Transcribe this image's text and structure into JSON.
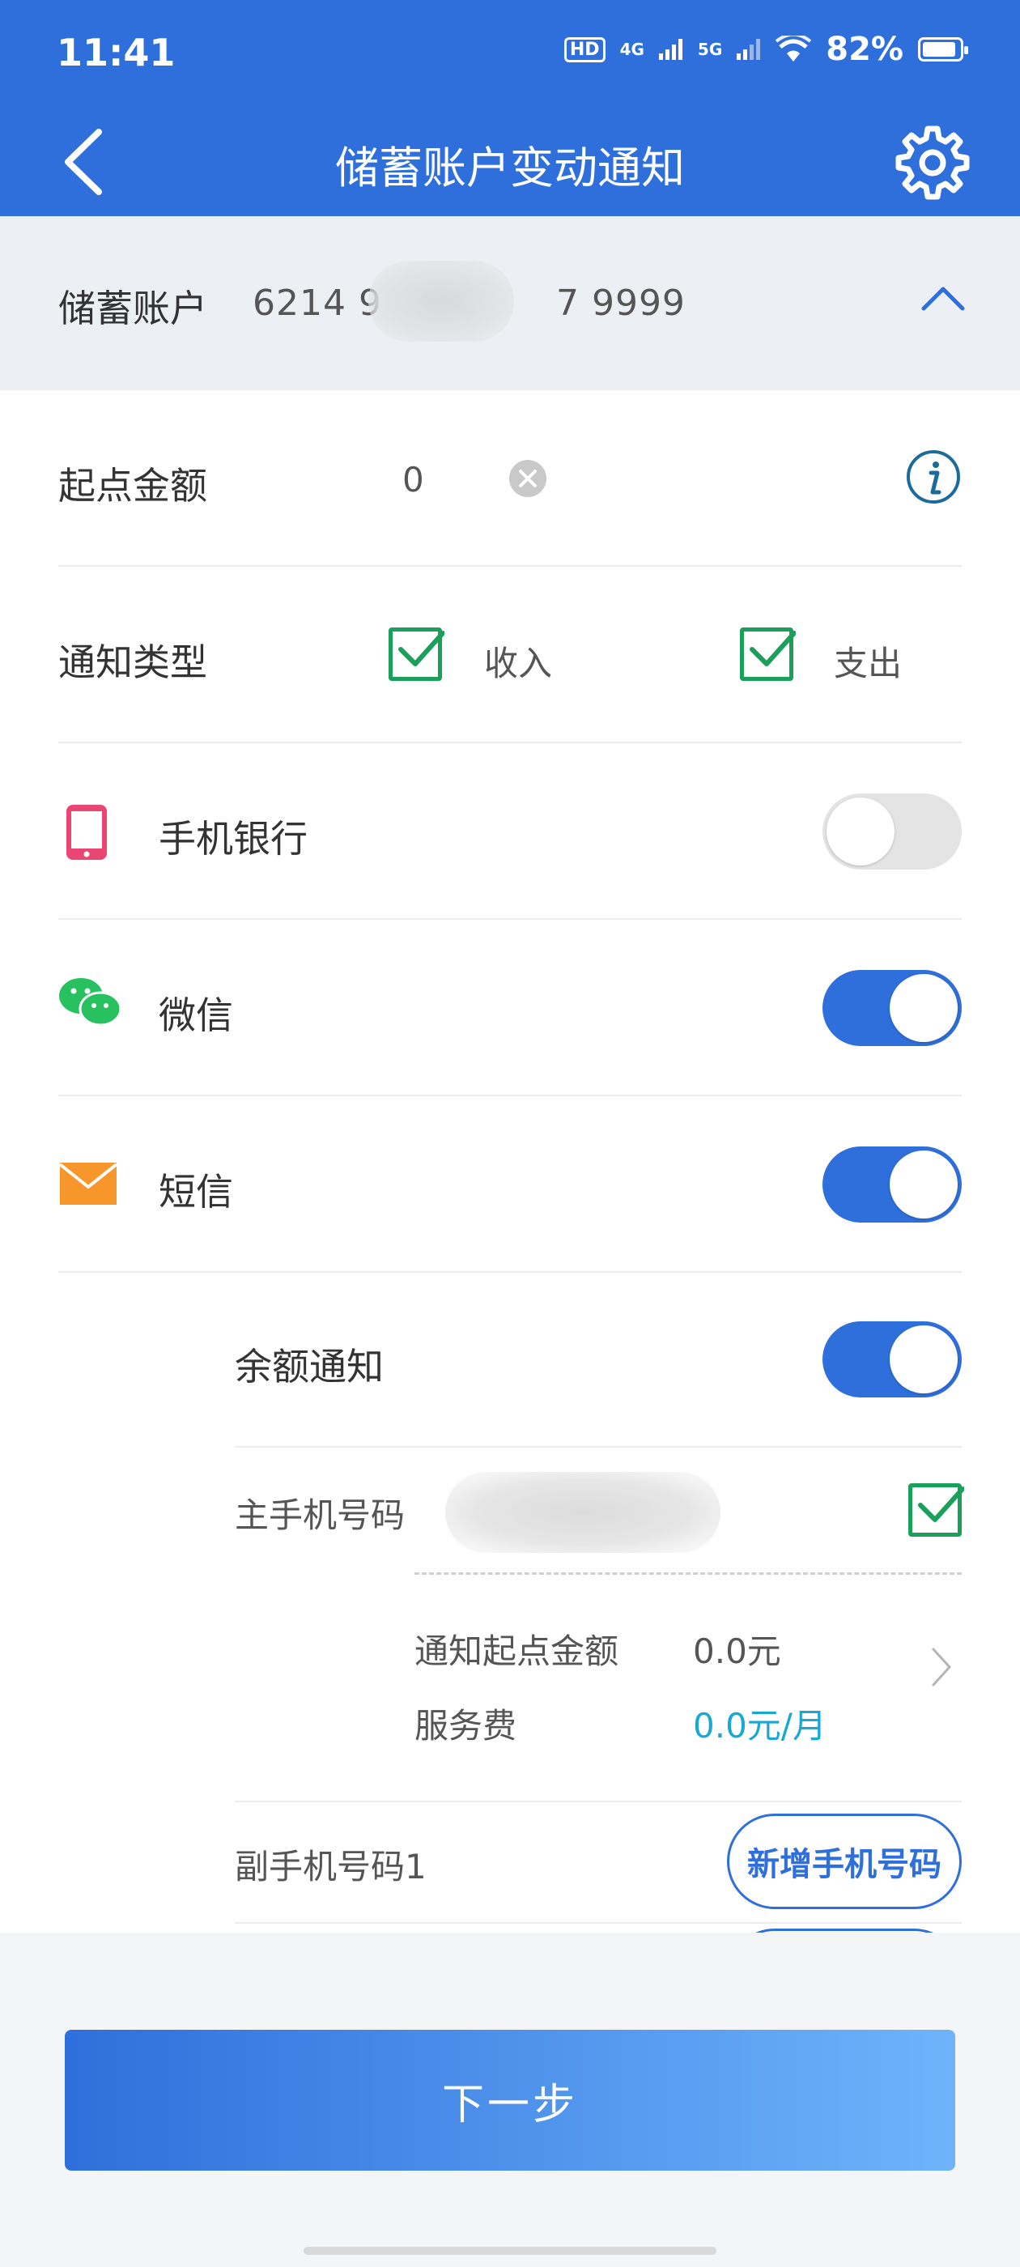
{
  "status_bar": {
    "time": "11:41",
    "hd": "HD",
    "net_4g": "4G",
    "net_5g": "5G",
    "battery": "82%"
  },
  "header": {
    "title": "储蓄账户变动通知"
  },
  "account": {
    "label": "储蓄账户",
    "number_start": "6214 9",
    "number_end": "7 9999"
  },
  "threshold": {
    "label": "起点金额",
    "value": "0"
  },
  "notify_type": {
    "label": "通知类型",
    "income": "收入",
    "expense": "支出"
  },
  "channels": {
    "mobile_bank": {
      "label": "手机银行",
      "enabled": false
    },
    "wechat": {
      "label": "微信",
      "enabled": true
    },
    "sms": {
      "label": "短信",
      "enabled": true
    }
  },
  "balance_notify": {
    "label": "余额通知",
    "enabled": true
  },
  "primary_phone": {
    "label": "主手机号码",
    "threshold_label": "通知起点金额",
    "threshold_value": "0.0元",
    "fee_label": "服务费",
    "fee_value": "0.0元/月"
  },
  "secondary_phone": {
    "label": "副手机号码1",
    "add_button": "新增手机号码"
  },
  "next_button": "下一步",
  "colors": {
    "brand_blue": "#2e6fdb",
    "check_green": "#1aa05a",
    "fee_cyan": "#19a7d6"
  }
}
